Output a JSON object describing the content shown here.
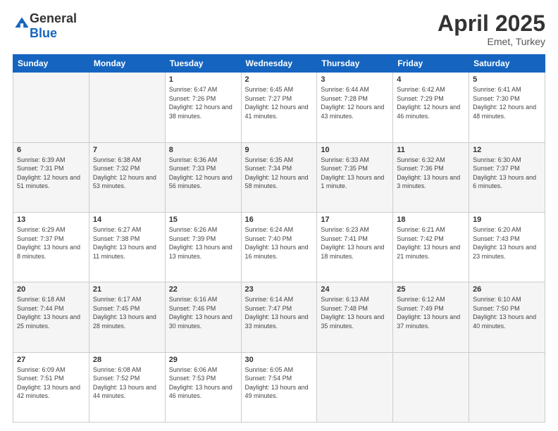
{
  "header": {
    "logo_general": "General",
    "logo_blue": "Blue",
    "title": "April 2025",
    "location": "Emet, Turkey"
  },
  "days_of_week": [
    "Sunday",
    "Monday",
    "Tuesday",
    "Wednesday",
    "Thursday",
    "Friday",
    "Saturday"
  ],
  "weeks": [
    [
      {
        "day": "",
        "info": ""
      },
      {
        "day": "",
        "info": ""
      },
      {
        "day": "1",
        "info": "Sunrise: 6:47 AM\nSunset: 7:26 PM\nDaylight: 12 hours and 38 minutes."
      },
      {
        "day": "2",
        "info": "Sunrise: 6:45 AM\nSunset: 7:27 PM\nDaylight: 12 hours and 41 minutes."
      },
      {
        "day": "3",
        "info": "Sunrise: 6:44 AM\nSunset: 7:28 PM\nDaylight: 12 hours and 43 minutes."
      },
      {
        "day": "4",
        "info": "Sunrise: 6:42 AM\nSunset: 7:29 PM\nDaylight: 12 hours and 46 minutes."
      },
      {
        "day": "5",
        "info": "Sunrise: 6:41 AM\nSunset: 7:30 PM\nDaylight: 12 hours and 48 minutes."
      }
    ],
    [
      {
        "day": "6",
        "info": "Sunrise: 6:39 AM\nSunset: 7:31 PM\nDaylight: 12 hours and 51 minutes."
      },
      {
        "day": "7",
        "info": "Sunrise: 6:38 AM\nSunset: 7:32 PM\nDaylight: 12 hours and 53 minutes."
      },
      {
        "day": "8",
        "info": "Sunrise: 6:36 AM\nSunset: 7:33 PM\nDaylight: 12 hours and 56 minutes."
      },
      {
        "day": "9",
        "info": "Sunrise: 6:35 AM\nSunset: 7:34 PM\nDaylight: 12 hours and 58 minutes."
      },
      {
        "day": "10",
        "info": "Sunrise: 6:33 AM\nSunset: 7:35 PM\nDaylight: 13 hours and 1 minute."
      },
      {
        "day": "11",
        "info": "Sunrise: 6:32 AM\nSunset: 7:36 PM\nDaylight: 13 hours and 3 minutes."
      },
      {
        "day": "12",
        "info": "Sunrise: 6:30 AM\nSunset: 7:37 PM\nDaylight: 13 hours and 6 minutes."
      }
    ],
    [
      {
        "day": "13",
        "info": "Sunrise: 6:29 AM\nSunset: 7:37 PM\nDaylight: 13 hours and 8 minutes."
      },
      {
        "day": "14",
        "info": "Sunrise: 6:27 AM\nSunset: 7:38 PM\nDaylight: 13 hours and 11 minutes."
      },
      {
        "day": "15",
        "info": "Sunrise: 6:26 AM\nSunset: 7:39 PM\nDaylight: 13 hours and 13 minutes."
      },
      {
        "day": "16",
        "info": "Sunrise: 6:24 AM\nSunset: 7:40 PM\nDaylight: 13 hours and 16 minutes."
      },
      {
        "day": "17",
        "info": "Sunrise: 6:23 AM\nSunset: 7:41 PM\nDaylight: 13 hours and 18 minutes."
      },
      {
        "day": "18",
        "info": "Sunrise: 6:21 AM\nSunset: 7:42 PM\nDaylight: 13 hours and 21 minutes."
      },
      {
        "day": "19",
        "info": "Sunrise: 6:20 AM\nSunset: 7:43 PM\nDaylight: 13 hours and 23 minutes."
      }
    ],
    [
      {
        "day": "20",
        "info": "Sunrise: 6:18 AM\nSunset: 7:44 PM\nDaylight: 13 hours and 25 minutes."
      },
      {
        "day": "21",
        "info": "Sunrise: 6:17 AM\nSunset: 7:45 PM\nDaylight: 13 hours and 28 minutes."
      },
      {
        "day": "22",
        "info": "Sunrise: 6:16 AM\nSunset: 7:46 PM\nDaylight: 13 hours and 30 minutes."
      },
      {
        "day": "23",
        "info": "Sunrise: 6:14 AM\nSunset: 7:47 PM\nDaylight: 13 hours and 33 minutes."
      },
      {
        "day": "24",
        "info": "Sunrise: 6:13 AM\nSunset: 7:48 PM\nDaylight: 13 hours and 35 minutes."
      },
      {
        "day": "25",
        "info": "Sunrise: 6:12 AM\nSunset: 7:49 PM\nDaylight: 13 hours and 37 minutes."
      },
      {
        "day": "26",
        "info": "Sunrise: 6:10 AM\nSunset: 7:50 PM\nDaylight: 13 hours and 40 minutes."
      }
    ],
    [
      {
        "day": "27",
        "info": "Sunrise: 6:09 AM\nSunset: 7:51 PM\nDaylight: 13 hours and 42 minutes."
      },
      {
        "day": "28",
        "info": "Sunrise: 6:08 AM\nSunset: 7:52 PM\nDaylight: 13 hours and 44 minutes."
      },
      {
        "day": "29",
        "info": "Sunrise: 6:06 AM\nSunset: 7:53 PM\nDaylight: 13 hours and 46 minutes."
      },
      {
        "day": "30",
        "info": "Sunrise: 6:05 AM\nSunset: 7:54 PM\nDaylight: 13 hours and 49 minutes."
      },
      {
        "day": "",
        "info": ""
      },
      {
        "day": "",
        "info": ""
      },
      {
        "day": "",
        "info": ""
      }
    ]
  ]
}
